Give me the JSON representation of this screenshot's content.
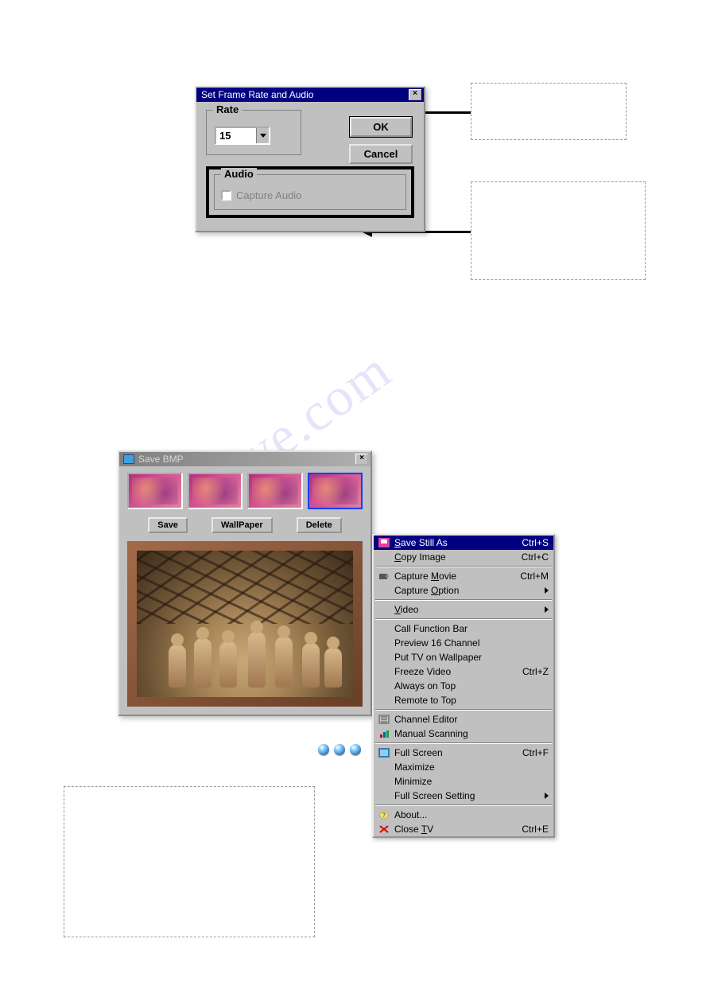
{
  "dialog1": {
    "title": "Set Frame Rate and Audio",
    "rate_group_label": "Rate",
    "rate_value": "15",
    "ok_label": "OK",
    "cancel_label": "Cancel",
    "audio_group_label": "Audio",
    "capture_audio_label": "Capture Audio"
  },
  "savebmp": {
    "title": "Save BMP",
    "save_label": "Save",
    "wallpaper_label": "WallPaper",
    "delete_label": "Delete"
  },
  "context_menu": {
    "items": [
      {
        "label_pre": "",
        "ul": "S",
        "label_post": "ave Still As",
        "accel": "Ctrl+S",
        "icon": "save-pink",
        "hl": true
      },
      {
        "label_pre": "",
        "ul": "C",
        "label_post": "opy Image",
        "accel": "Ctrl+C"
      },
      {
        "sep": true
      },
      {
        "label_pre": "Capture ",
        "ul": "M",
        "label_post": "ovie",
        "accel": "Ctrl+M",
        "icon": "camera"
      },
      {
        "label_pre": "Capture ",
        "ul": "O",
        "label_post": "ption",
        "submenu": true
      },
      {
        "sep": true
      },
      {
        "label_pre": "",
        "ul": "V",
        "label_post": "ideo",
        "submenu": true
      },
      {
        "sep": true
      },
      {
        "label_pre": "Call Function Bar",
        "ul": "",
        "label_post": ""
      },
      {
        "label_pre": "Preview 16 Channel",
        "ul": "",
        "label_post": ""
      },
      {
        "label_pre": "Put TV on Wallpaper",
        "ul": "",
        "label_post": ""
      },
      {
        "label_pre": "Freeze Video",
        "ul": "",
        "label_post": "",
        "accel": "Ctrl+Z"
      },
      {
        "label_pre": "Always on Top",
        "ul": "",
        "label_post": ""
      },
      {
        "label_pre": "Remote to Top",
        "ul": "",
        "label_post": ""
      },
      {
        "sep": true
      },
      {
        "label_pre": "Channel Editor",
        "ul": "",
        "label_post": "",
        "icon": "list"
      },
      {
        "label_pre": "Manual Scanning",
        "ul": "",
        "label_post": "",
        "icon": "scan"
      },
      {
        "sep": true
      },
      {
        "label_pre": "Full Screen",
        "ul": "",
        "label_post": "",
        "accel": "Ctrl+F",
        "icon": "fullscreen"
      },
      {
        "label_pre": "Maximize",
        "ul": "",
        "label_post": ""
      },
      {
        "label_pre": "Minimize",
        "ul": "",
        "label_post": ""
      },
      {
        "label_pre": "Full Screen Setting",
        "ul": "",
        "label_post": "",
        "submenu": true
      },
      {
        "sep": true
      },
      {
        "label_pre": "About...",
        "ul": "",
        "label_post": "",
        "icon": "help"
      },
      {
        "label_pre": "Close ",
        "ul": "T",
        "label_post": "V",
        "accel": "Ctrl+E",
        "icon": "close-red"
      }
    ]
  }
}
